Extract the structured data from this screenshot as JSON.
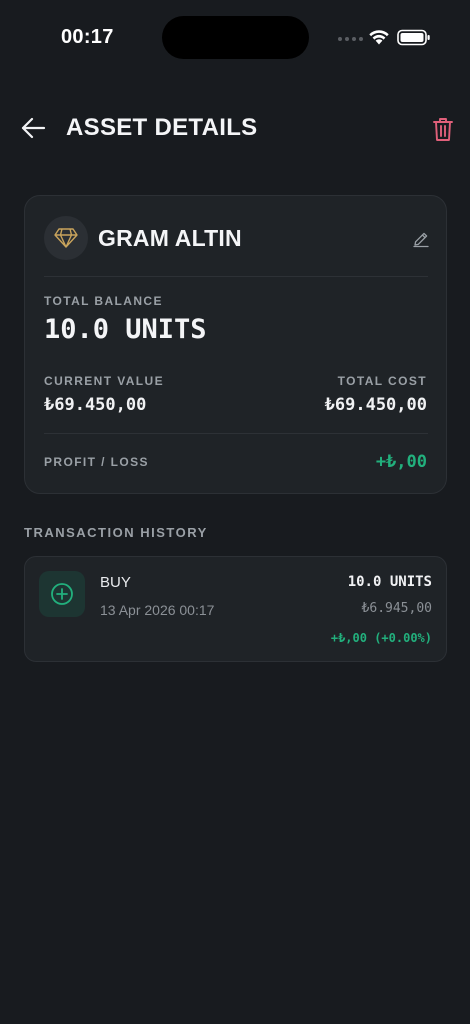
{
  "status_bar": {
    "time": "00:17"
  },
  "header": {
    "title": "ASSET DETAILS"
  },
  "asset": {
    "name": "GRAM ALTIN",
    "total_balance_label": "TOTAL BALANCE",
    "total_balance": "10.0 UNITS",
    "current_value_label": "CURRENT VALUE",
    "current_value": "₺69.450,00",
    "total_cost_label": "TOTAL COST",
    "total_cost": "₺69.450,00",
    "profit_loss_label": "PROFIT / LOSS",
    "profit_loss": "+₺,00"
  },
  "history": {
    "title": "TRANSACTION HISTORY",
    "items": [
      {
        "type": "BUY",
        "date": "13 Apr 2026 00:17",
        "units": "10.0 UNITS",
        "price": "₺6.945,00",
        "pl": "+₺,00 (+0.00%)"
      }
    ]
  },
  "colors": {
    "background": "#181b1f",
    "card": "#1f2327",
    "profit_green": "#22b07d",
    "delete_red": "#e0607a",
    "gold": "#c9a45c"
  }
}
